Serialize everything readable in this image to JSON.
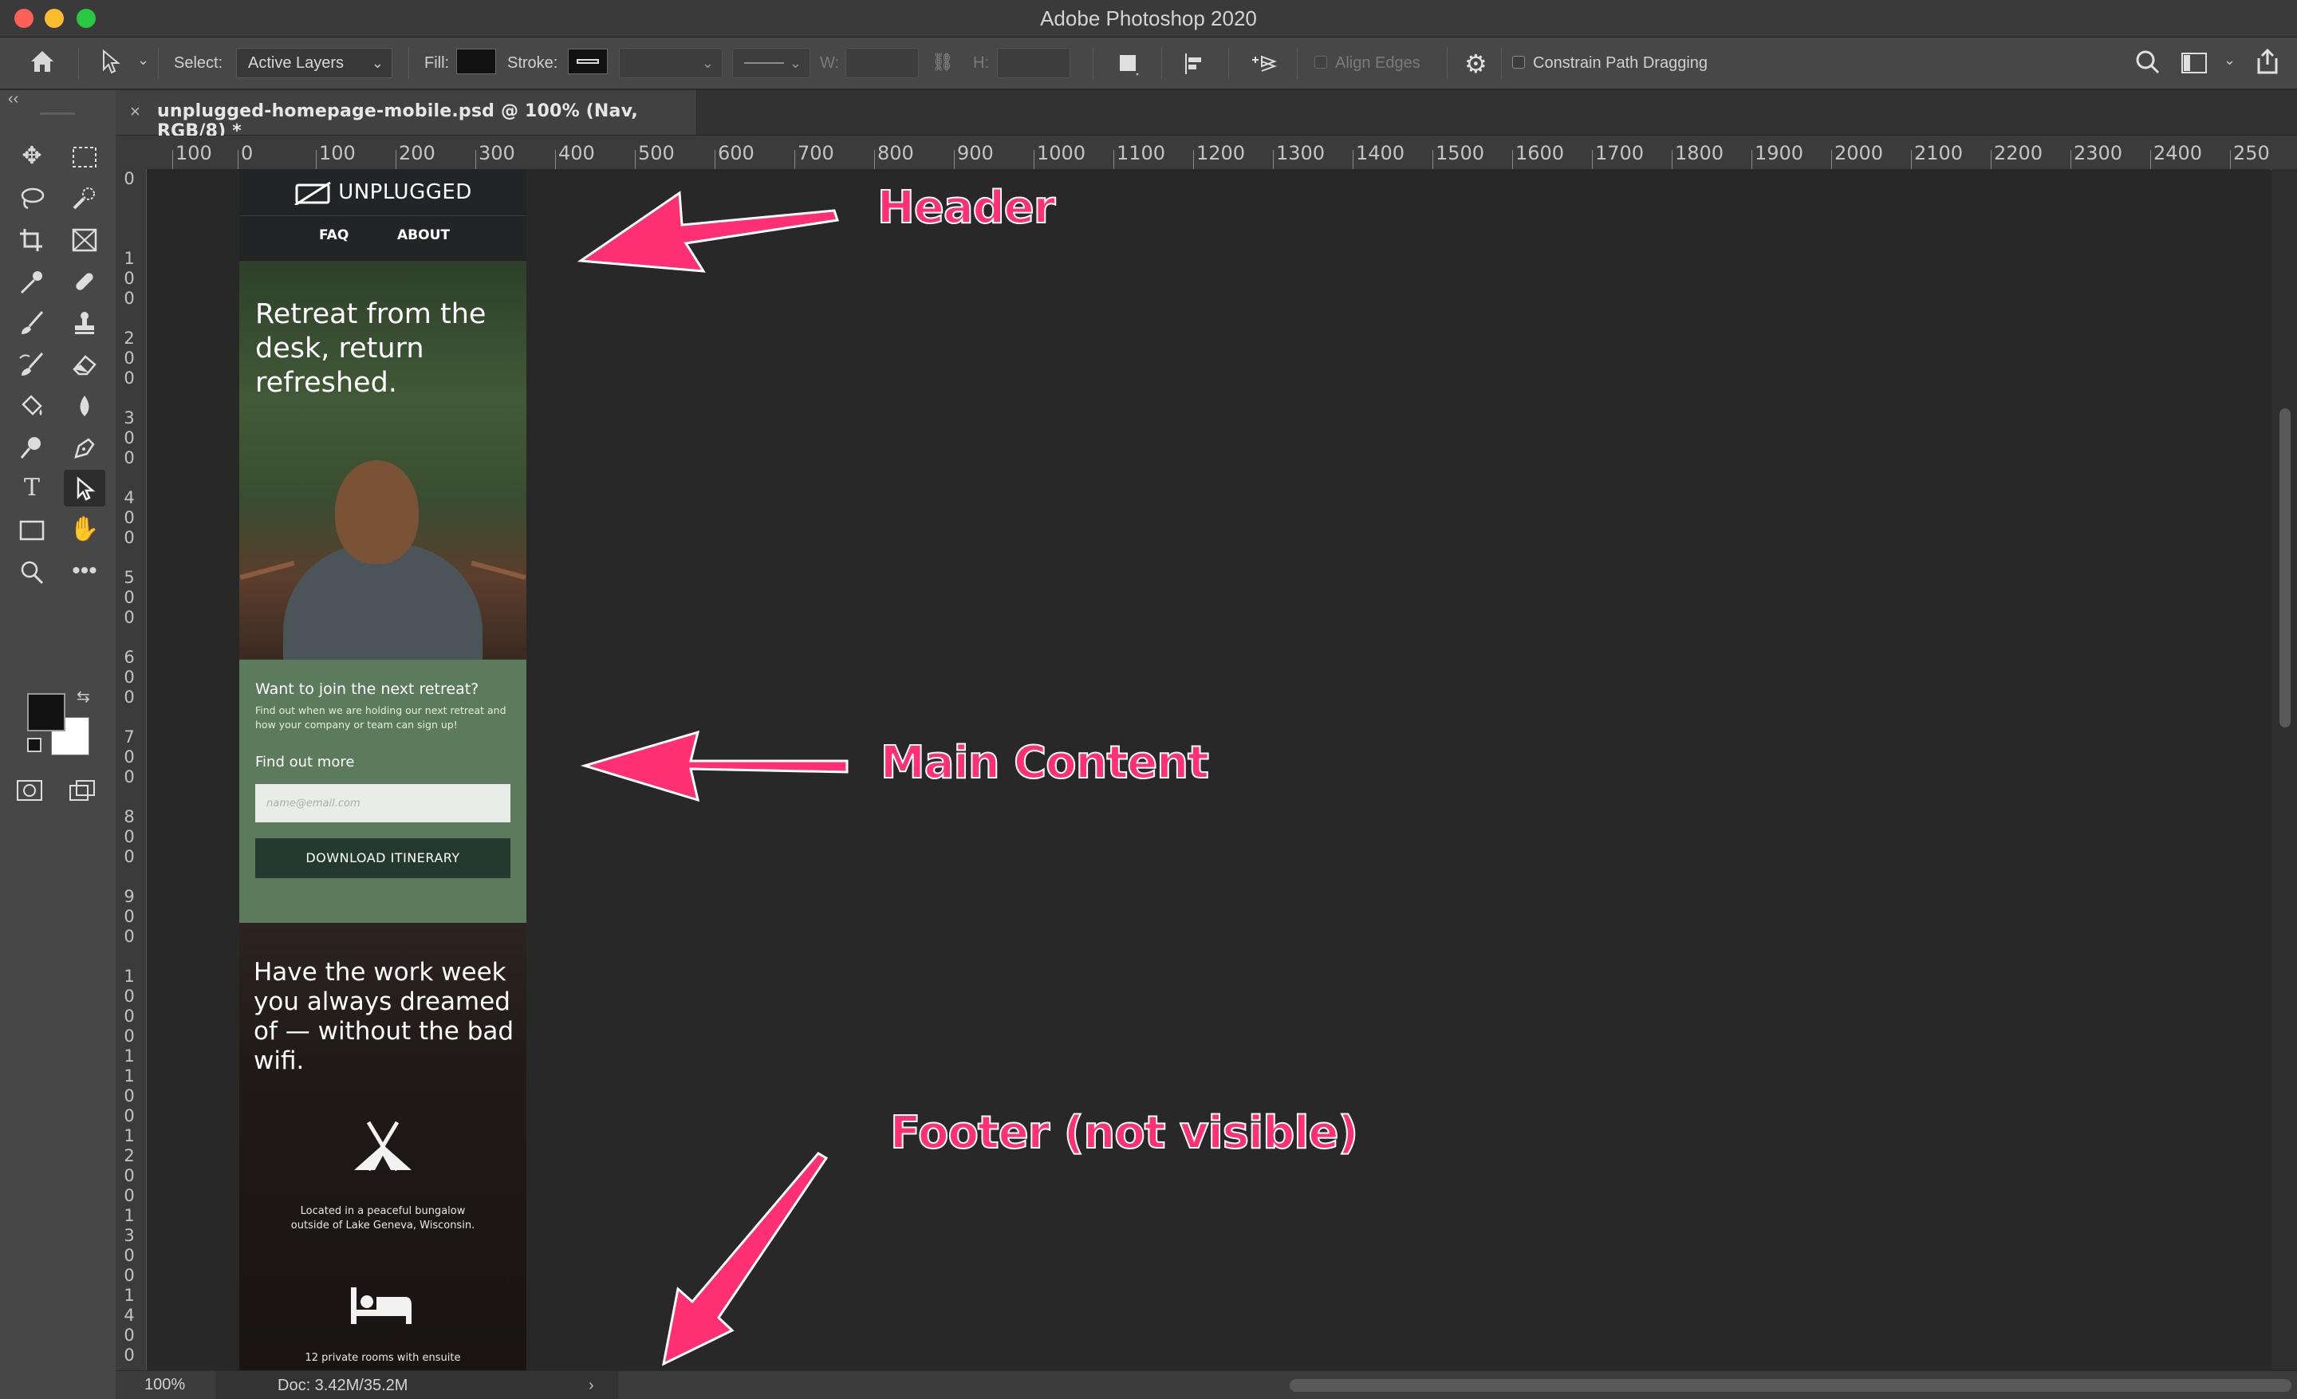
{
  "window": {
    "title": "Adobe Photoshop 2020"
  },
  "options_bar": {
    "select_label": "Select:",
    "select_value": "Active Layers",
    "fill_label": "Fill:",
    "stroke_label": "Stroke:",
    "w_label": "W:",
    "h_label": "H:",
    "align_edges_label": "Align Edges",
    "constrain_label": "Constrain Path Dragging"
  },
  "document_tab": {
    "close": "×",
    "name": "unplugged-homepage-mobile.psd @ 100% (Nav, RGB/8) *"
  },
  "ruler_top": [
    "100",
    "0",
    "100",
    "200",
    "300",
    "400",
    "500",
    "600",
    "700",
    "800",
    "900",
    "1000",
    "1100",
    "1200",
    "1300",
    "1400",
    "1500",
    "1600",
    "1700",
    "1800",
    "1900",
    "2000",
    "2100",
    "2200",
    "2300",
    "2400",
    "250"
  ],
  "ruler_left": [
    "0",
    "1\n0\n0",
    "2\n0\n0",
    "3\n0\n0",
    "4\n0\n0",
    "5\n0\n0",
    "6\n0\n0",
    "7\n0\n0",
    "8\n0\n0",
    "9\n0\n0",
    "1\n0\n0\n0",
    "1\n1\n0\n0",
    "1\n2\n0\n0",
    "1\n3\n0\n0",
    "1\n4\n0\n0"
  ],
  "status": {
    "zoom": "100%",
    "doc": "Doc: 3.42M/35.2M",
    "arrow": "›"
  },
  "artboard": {
    "logo": "UNPLUGGED",
    "nav": [
      "FAQ",
      "ABOUT"
    ],
    "hero_text": "Retreat from the desk, return refreshed.",
    "signup": {
      "question": "Want to join the next retreat?",
      "description": "Find out when we are holding our next retreat and how your company or team can sign up!",
      "find_out": "Find out more",
      "email_placeholder": "name@email.com",
      "button": "DOWNLOAD ITINERARY"
    },
    "features": {
      "heading": "Have the work week you always dreamed of — without the bad wifi.",
      "item1": "Located in a peaceful bungalow outside of Lake Geneva, Wisconsin.",
      "item2": "12 private rooms with ensuite"
    }
  },
  "annotations": {
    "header": "Header",
    "main": "Main Content",
    "footer": "Footer (not visible)",
    "color": "#ff2f74"
  },
  "tools": [
    "move-icon",
    "marquee-icon",
    "lasso-icon",
    "quick-select-icon",
    "crop-icon",
    "frame-icon",
    "eyedropper-icon",
    "healing-icon",
    "brush-icon",
    "stamp-icon",
    "history-brush-icon",
    "eraser-icon",
    "paint-bucket-icon",
    "blur-icon",
    "dodge-icon",
    "pen-icon",
    "type-icon",
    "path-select-icon",
    "rectangle-icon",
    "hand-icon",
    "zoom-icon",
    "more-tools-icon"
  ]
}
